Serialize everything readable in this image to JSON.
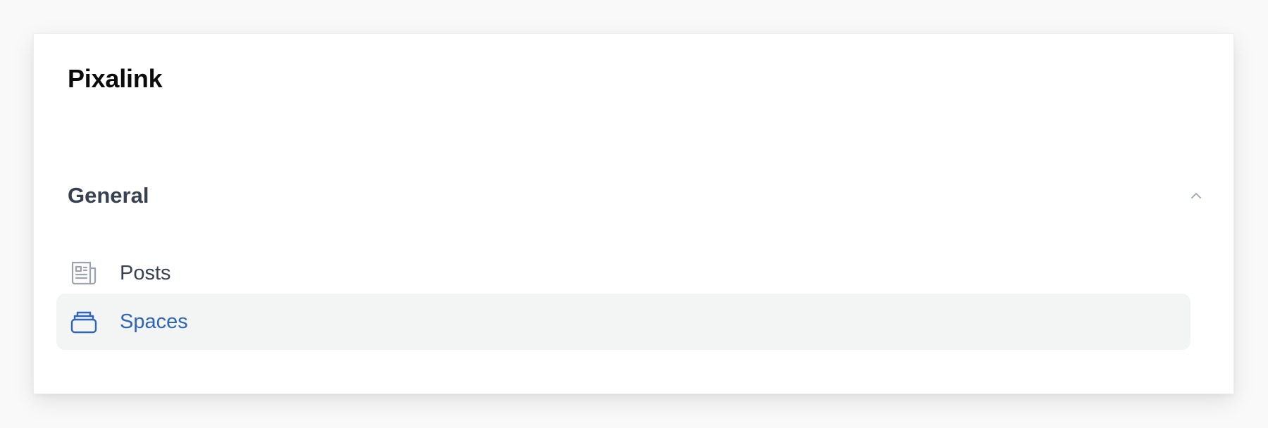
{
  "app": {
    "brand": "Pixalink"
  },
  "nav": {
    "group": {
      "label": "General",
      "collapse_icon": "chevron-up-icon",
      "expanded": true
    },
    "items": [
      {
        "label": "Posts",
        "icon": "newspaper-icon",
        "active": false
      },
      {
        "label": "Spaces",
        "icon": "stacked-cards-icon",
        "active": true
      }
    ]
  },
  "colors": {
    "active": "#2f64b8",
    "active_background": "#f3f4f4",
    "inactive_icon": "#9ca3af",
    "text": "#374151"
  }
}
